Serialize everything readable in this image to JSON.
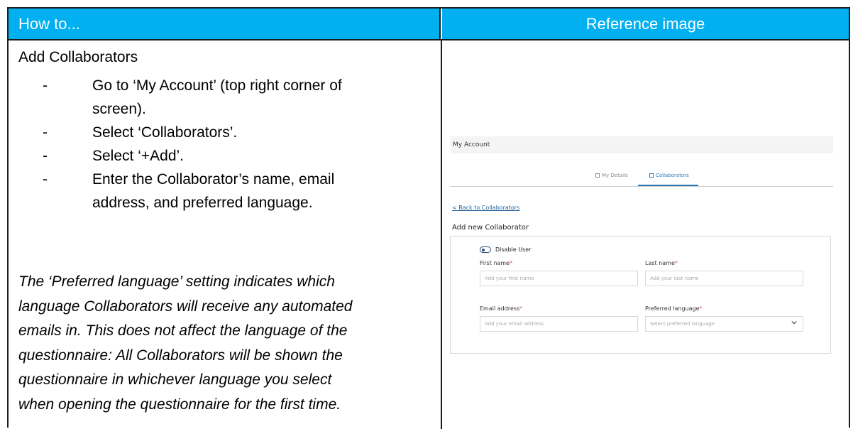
{
  "header": {
    "left": "How to...",
    "right": "Reference image"
  },
  "section": {
    "title": "Add Collaborators",
    "steps": [
      {
        "dash": "-",
        "line1": "Go to ‘My Account’ (top right corner of",
        "line2": "screen)."
      },
      {
        "dash": "-",
        "line1": "Select ‘Collaborators’."
      },
      {
        "dash": "-",
        "line1": "Select ‘+Add’."
      },
      {
        "dash": "-",
        "line1": "Enter the Collaborator’s name, email",
        "line2": "address, and preferred language."
      }
    ],
    "note": [
      "The ‘Preferred language’ setting indicates which",
      "language Collaborators will receive any automated",
      "emails in. This does not affect the language of the",
      "questionnaire: All Collaborators will be shown the",
      "questionnaire in whichever language you select",
      "when opening the questionnaire for the first time."
    ]
  },
  "reference": {
    "bar_title": "My Account",
    "tabs": {
      "my_details": "My Details",
      "collaborators": "Collaborators"
    },
    "back_link": "< Back to Collaborators",
    "add_title": "Add new Collaborator",
    "disable_user": "Disable User",
    "first_name_label": "First name",
    "last_name_label": "Last name",
    "email_label": "Email address",
    "language_label": "Preferred language",
    "required_mark": "*",
    "first_name_placeholder": "Add your first name",
    "last_name_placeholder": "Add your last name",
    "email_placeholder": "Add your email address",
    "language_placeholder": "Select preferred language"
  },
  "colors": {
    "header_bg": "#00b0f0",
    "accent": "#2b7ab8",
    "required": "#d9534f"
  }
}
